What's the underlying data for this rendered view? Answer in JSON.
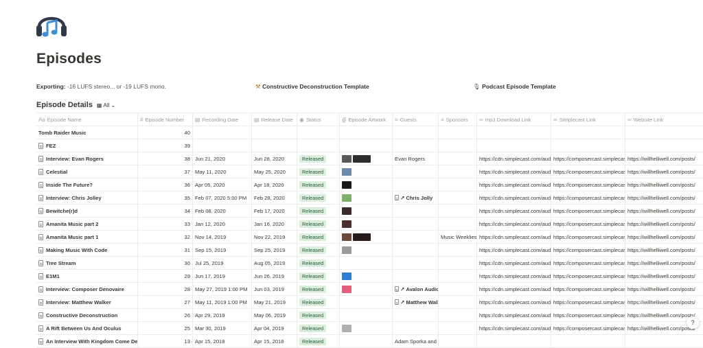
{
  "page": {
    "title": "Episodes",
    "icon": "headphones-music-icon"
  },
  "properties": {
    "exporting_label": "Exporting:",
    "exporting_value": "-16 LUFS stereo... or -19 LUFS mono.",
    "template1": "Constructive Deconstruction Template",
    "template2": "Podcast Episode Template"
  },
  "database": {
    "title": "Episode Details",
    "view": "All"
  },
  "columns": {
    "name": "Episode Name",
    "num": "Episode Number",
    "rec": "Recording Date",
    "rel": "Release Date",
    "status": "Status",
    "art": "Episode Artwork",
    "guests": "Guests",
    "sponsors": "Sponsors",
    "mp3": "mp3 Download Link",
    "simplecast": "Simplecast Link",
    "website": "Website Link"
  },
  "colors": {
    "status_bg": "#dbeddb",
    "status_text": "#2b593f",
    "text": "#37352f",
    "muted": "#9b9a97"
  },
  "rows": [
    {
      "name": "Tomb Raider Music",
      "page": false,
      "num": "40",
      "rec": "",
      "rel": "",
      "status": "",
      "art": [],
      "guest": "",
      "guest_link": false,
      "sponsor": "",
      "mp3": "",
      "sc": "",
      "web": ""
    },
    {
      "name": "FEZ",
      "page": true,
      "num": "39",
      "rec": "",
      "rel": "",
      "status": "",
      "art": [],
      "guest": "",
      "guest_link": false,
      "sponsor": "",
      "mp3": "",
      "sc": "",
      "web": ""
    },
    {
      "name": "Interview: Evan Rogers",
      "page": true,
      "num": "38",
      "rec": "Jun 21, 2020",
      "rel": "Jun 28, 2020",
      "status": "Released",
      "art": [
        "#5a5a5a",
        "#2d2d2d"
      ],
      "guest": "Evan Rogers",
      "guest_link": false,
      "sponsor": "",
      "mp3": "https://cdn.simplecast.com/audio",
      "sc": "https://composercast.simplecast",
      "web": "https://willhelliwell.com/posts/"
    },
    {
      "name": "Celestial",
      "page": true,
      "num": "37",
      "rec": "May 11, 2020",
      "rel": "May 25, 2020",
      "status": "Released",
      "art": [
        "#6b8aa8"
      ],
      "guest": "",
      "guest_link": false,
      "sponsor": "",
      "mp3": "https://cdn.simplecast.com/audio",
      "sc": "https://composercast.simplecast",
      "web": "https://willhelliwell.com/posts/"
    },
    {
      "name": "Inside The Future?",
      "page": true,
      "num": "36",
      "rec": "Apr 05, 2020",
      "rel": "Apr 18, 2020",
      "status": "Released",
      "art": [
        "#1a1a1a"
      ],
      "guest": "",
      "guest_link": false,
      "sponsor": "",
      "mp3": "https://cdn.simplecast.com/audio",
      "sc": "https://composercast.simplecast",
      "web": "https://willhelliwell.com/posts/"
    },
    {
      "name": "Interview: Chris Jolley",
      "page": true,
      "num": "35",
      "rec": "Feb 07, 2020 5:00 PM",
      "rel": "Feb 28, 2020",
      "status": "Released",
      "art": [
        "#7fb06a"
      ],
      "guest": "Chris Jolly",
      "guest_link": true,
      "sponsor": "",
      "mp3": "https://cdn.simplecast.com/audio",
      "sc": "https://composercast.simplecast",
      "web": "https://willhelliwell.com/posts/"
    },
    {
      "name": "Bewitche(r)d",
      "page": true,
      "num": "34",
      "rec": "Feb 08, 2020",
      "rel": "Feb 17, 2020",
      "status": "Released",
      "art": [
        "#3a2a2a"
      ],
      "guest": "",
      "guest_link": false,
      "sponsor": "",
      "mp3": "https://cdn.simplecast.com/audio",
      "sc": "https://composercast.simplecast",
      "web": "https://willhelliwell.com/posts/"
    },
    {
      "name": "Amanita Music part 2",
      "page": true,
      "num": "33",
      "rec": "Jan 12, 2020",
      "rel": "Jan 16, 2020",
      "status": "Released",
      "art": [
        "#4a2f2a"
      ],
      "guest": "",
      "guest_link": false,
      "sponsor": "",
      "mp3": "https://cdn.simplecast.com/audio",
      "sc": "https://composercast.simplecast",
      "web": "https://willhelliwell.com/posts/"
    },
    {
      "name": "Amanita Music part 1",
      "page": true,
      "num": "32",
      "rec": "Nov 14, 2019",
      "rel": "Nov 22, 2019",
      "status": "Released",
      "art": [
        "#6a4a3a",
        "#2a1a1a"
      ],
      "guest": "",
      "guest_link": false,
      "sponsor": "Music Weeklies",
      "mp3": "https://cdn.simplecast.com/audio",
      "sc": "https://composercast.simplecast",
      "web": "https://willhelliwell.com/posts/"
    },
    {
      "name": "Making Music With Code",
      "page": true,
      "num": "31",
      "rec": "Sep 15, 2019",
      "rel": "Sep 25, 2019",
      "status": "Released",
      "art": [
        "#9a9a9a"
      ],
      "guest": "",
      "guest_link": false,
      "sponsor": "",
      "mp3": "https://cdn.simplecast.com/audio",
      "sc": "https://composercast.simplecast",
      "web": "https://willhelliwell.com/posts/"
    },
    {
      "name": "Tree Stream",
      "page": true,
      "num": "30",
      "rec": "Jul 25, 2019",
      "rel": "Aug 05, 2019",
      "status": "Released",
      "art": [],
      "guest": "",
      "guest_link": false,
      "sponsor": "",
      "mp3": "https://cdn.simplecast.com/audio",
      "sc": "https://composercast.simplecast",
      "web": "https://willhelliwell.com/posts/"
    },
    {
      "name": "E1M1",
      "page": true,
      "num": "29",
      "rec": "Jun 17, 2019",
      "rel": "Jun 26, 2019",
      "status": "Released",
      "art": [
        "#2f7fd0"
      ],
      "guest": "",
      "guest_link": false,
      "sponsor": "",
      "mp3": "https://cdn.simplecast.com/audio",
      "sc": "https://composercast.simplecast",
      "web": "https://willhelliwell.com/posts/"
    },
    {
      "name": "Interview: Composer Denovaire",
      "page": true,
      "num": "28",
      "rec": "May 27, 2019 1:00 PM",
      "rel": "Jun 03, 2019",
      "status": "Released",
      "art": [
        "#e0607a"
      ],
      "guest": "Avalon Audio",
      "guest_link": true,
      "sponsor": "",
      "mp3": "https://cdn.simplecast.com/audio",
      "sc": "https://composercast.simplecast",
      "web": "https://willhelliwell.com/posts/"
    },
    {
      "name": "Interview: Matthew Walker",
      "page": true,
      "num": "27",
      "rec": "May 11, 2019 1:00 PM",
      "rel": "May 21, 2019",
      "status": "Released",
      "art": [],
      "guest": "Matthew Walker",
      "guest_link": true,
      "sponsor": "",
      "mp3": "https://cdn.simplecast.com/audio",
      "sc": "https://composercast.simplecast",
      "web": "https://willhelliwell.com/posts/"
    },
    {
      "name": "Constructive Deconstruction",
      "page": true,
      "num": "26",
      "rec": "Apr 29, 2019",
      "rel": "May 06, 2019",
      "status": "Released",
      "art": [],
      "guest": "",
      "guest_link": false,
      "sponsor": "",
      "mp3": "https://cdn.simplecast.com/audio",
      "sc": "https://composercast.simplecast",
      "web": "https://willhelliwell.com/posts/"
    },
    {
      "name": "A Rift Between Us And Oculus",
      "page": true,
      "num": "25",
      "rec": "Mar 30, 2019",
      "rel": "Apr 04, 2019",
      "status": "Released",
      "art": [
        "#b0b0b0"
      ],
      "guest": "",
      "guest_link": false,
      "sponsor": "",
      "mp3": "https://cdn.simplecast.com/audio",
      "sc": "https://composercast.simplecast",
      "web": "https://willhelliwell.com/posts/"
    },
    {
      "name": "An Interview With Kingdom Come Deliverance",
      "page": true,
      "num": "13",
      "rec": "Apr 15, 2018",
      "rel": "Apr 15, 2018",
      "status": "Released",
      "art": [],
      "guest": "Adam Sporka and",
      "guest_link": false,
      "sponsor": "",
      "mp3": "",
      "sc": "",
      "web": ""
    }
  ],
  "help_label": "?"
}
